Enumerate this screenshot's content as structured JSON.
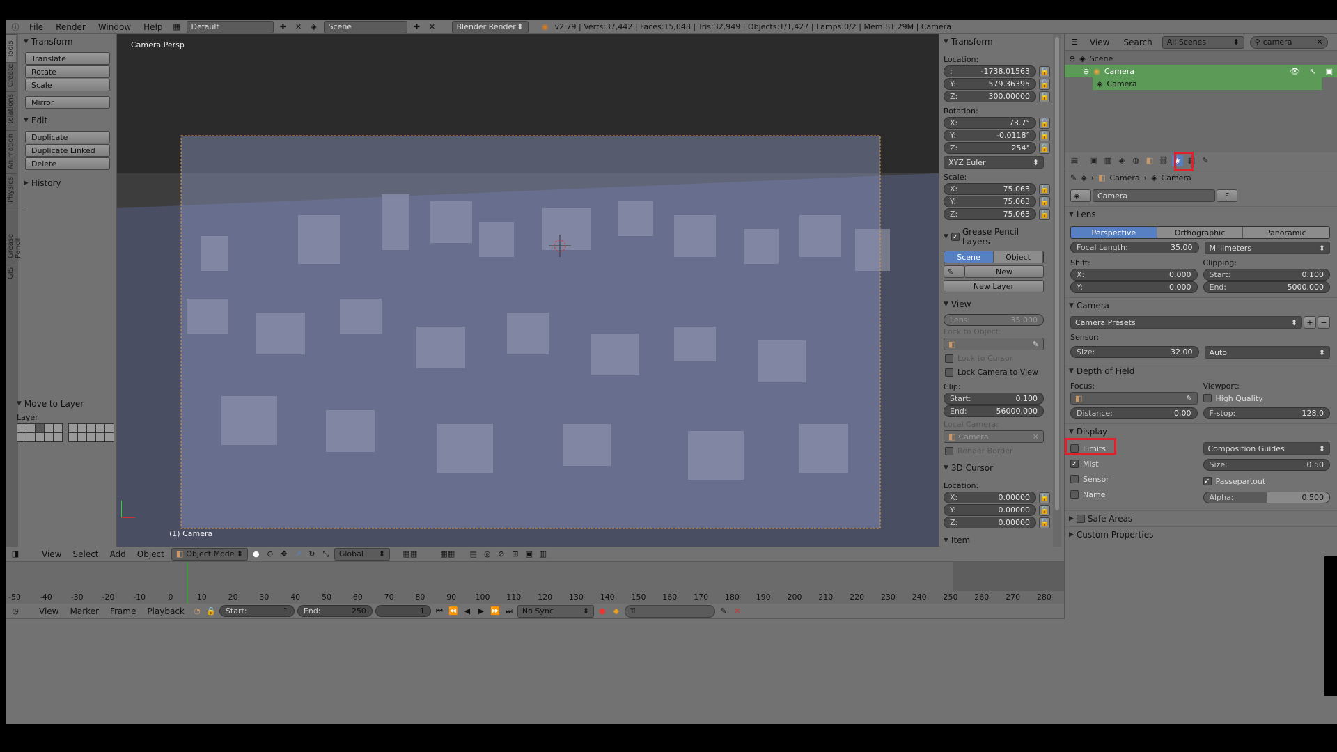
{
  "top_bar": {
    "menus": [
      "File",
      "Render",
      "Window",
      "Help"
    ],
    "layout": "Default",
    "scene": "Scene",
    "engine": "Blender Render",
    "stats": "v2.79 | Verts:37,442 | Faces:15,048 | Tris:32,949 | Objects:1/1,427 | Lamps:0/2 | Mem:81.29M | Camera"
  },
  "toolshelf": {
    "tabs": [
      "Tools",
      "Create",
      "Relations",
      "Animation",
      "Physics",
      "Grease Pencil",
      "GIS"
    ],
    "transform_title": "Transform",
    "transform_buttons": [
      "Translate",
      "Rotate",
      "Scale"
    ],
    "mirror": "Mirror",
    "edit_title": "Edit",
    "edit_buttons": [
      "Duplicate",
      "Duplicate Linked",
      "Delete"
    ],
    "history_title": "History",
    "move_layer_title": "Move to Layer",
    "layer_label": "Layer"
  },
  "viewport": {
    "label": "Camera Persp",
    "object_label": "(1) Camera"
  },
  "n_panel": {
    "transform_title": "Transform",
    "location_label": "Location:",
    "location": [
      {
        "k": ":",
        "v": "-1738.01563"
      },
      {
        "k": "Y:",
        "v": "579.36395"
      },
      {
        "k": "Z:",
        "v": "300.00000"
      }
    ],
    "rotation_label": "Rotation:",
    "rotation": [
      {
        "k": "X:",
        "v": "73.7°"
      },
      {
        "k": "Y:",
        "v": "-0.0118°"
      },
      {
        "k": "Z:",
        "v": "254°"
      }
    ],
    "rotation_mode": "XYZ Euler",
    "scale_label": "Scale:",
    "scale": [
      {
        "k": "X:",
        "v": "75.063"
      },
      {
        "k": "Y:",
        "v": "75.063"
      },
      {
        "k": "Z:",
        "v": "75.063"
      }
    ],
    "gp_title": "Grease Pencil Layers",
    "gp_scene": "Scene",
    "gp_object": "Object",
    "gp_new": "New",
    "gp_new_layer": "New Layer",
    "view_title": "View",
    "lens": "Lens:",
    "lens_val": "35.000",
    "lock_object": "Lock to Object:",
    "lock_cursor": "Lock to Cursor",
    "lock_camera": "Lock Camera to View",
    "clip_label": "Clip:",
    "clip_start_k": "Start:",
    "clip_start": "0.100",
    "clip_end_k": "End:",
    "clip_end": "56000.000",
    "local_camera": "Local Camera:",
    "local_camera_val": "Camera",
    "render_border": "Render Border",
    "cursor_title": "3D Cursor",
    "cursor_loc": "Location:",
    "cursor": [
      {
        "k": "X:",
        "v": "0.00000"
      },
      {
        "k": "Y:",
        "v": "0.00000"
      },
      {
        "k": "Z:",
        "v": "0.00000"
      }
    ],
    "item_title": "Item"
  },
  "outliner": {
    "view": "View",
    "search": "Search",
    "filter": "All Scenes",
    "query": "camera",
    "tree": [
      "Scene",
      "Camera",
      "Camera"
    ]
  },
  "properties": {
    "breadcrumb": [
      "Camera",
      "Camera"
    ],
    "datablock": "Camera",
    "fake": "F",
    "lens_title": "Lens",
    "lens_types": [
      "Perspective",
      "Orthographic",
      "Panoramic"
    ],
    "focal_k": "Focal Length:",
    "focal": "35.00",
    "units": "Millimeters",
    "shift": "Shift:",
    "shift_x_k": "X:",
    "shift_x": "0.000",
    "shift_y_k": "Y:",
    "shift_y": "0.000",
    "clipping": "Clipping:",
    "clip_start_k": "Start:",
    "clip_start": "0.100",
    "clip_end_k": "End:",
    "clip_end": "5000.000",
    "camera_title": "Camera",
    "presets": "Camera Presets",
    "sensor": "Sensor:",
    "size_k": "Size:",
    "size": "32.00",
    "fit": "Auto",
    "dof_title": "Depth of Field",
    "focus": "Focus:",
    "viewport": "Viewport:",
    "high_quality": "High Quality",
    "distance_k": "Distance:",
    "distance": "0.00",
    "fstop_k": "F-stop:",
    "fstop": "128.0",
    "display_title": "Display",
    "limits": "Limits",
    "mist": "Mist",
    "sensor_chk": "Sensor",
    "name": "Name",
    "guides": "Composition Guides",
    "gsize_k": "Size:",
    "gsize": "0.50",
    "passepartout": "Passepartout",
    "alpha_k": "Alpha:",
    "alpha": "0.500",
    "safe_areas": "Safe Areas",
    "custom_props": "Custom Properties"
  },
  "view3d_header": {
    "menus": [
      "View",
      "Select",
      "Add",
      "Object"
    ],
    "mode": "Object Mode",
    "orientation": "Global"
  },
  "timeline": {
    "ticks": [
      "-50",
      "-40",
      "-30",
      "-20",
      "-10",
      "0",
      "10",
      "20",
      "30",
      "40",
      "50",
      "60",
      "70",
      "80",
      "90",
      "100",
      "110",
      "120",
      "130",
      "140",
      "150",
      "160",
      "170",
      "180",
      "190",
      "200",
      "210",
      "220",
      "230",
      "240",
      "250",
      "260",
      "270",
      "280"
    ],
    "menus": [
      "View",
      "Marker",
      "Frame",
      "Playback"
    ],
    "start_k": "Start:",
    "start": "1",
    "end_k": "End:",
    "end": "250",
    "current": "1",
    "sync": "No Sync"
  }
}
